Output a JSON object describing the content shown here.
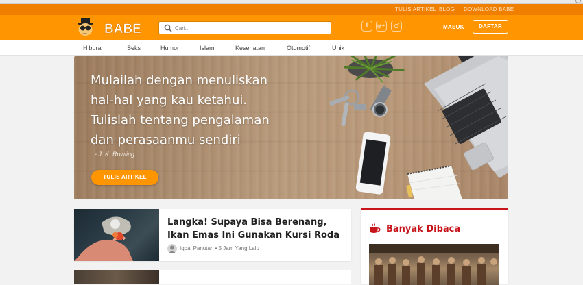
{
  "topbar": {
    "links": [
      "TULIS ARTIKEL",
      "BLOG",
      "DOWNLOAD BABE"
    ]
  },
  "header": {
    "logo_text": "BABE",
    "search_placeholder": "Cari...",
    "social_icons": [
      "facebook-icon",
      "google-plus-icon",
      "instagram-icon"
    ],
    "login_label": "MASUK",
    "register_label": "DAFTAR",
    "accent_color": "#ff9500"
  },
  "nav": {
    "items": [
      "Hiburan",
      "Seks",
      "Humor",
      "Islam",
      "Kesehatan",
      "Otomotif",
      "Unik"
    ]
  },
  "hero": {
    "quote_lines": [
      "Mulailah dengan menuliskan",
      "hal-hal yang kau ketahui.",
      "Tulislah tentang pengalaman",
      "dan perasaanmu sendiri"
    ],
    "author": "- J. K. Rowling",
    "cta_label": "TULIS ARTIKEL"
  },
  "articles": [
    {
      "title": "Langka! Supaya Bisa Berenang, Ikan Emas Ini Gunakan Kursi Roda",
      "author": "Iqbal Panutan",
      "time": "5 Jam Yang Lalu"
    }
  ],
  "sidebar": {
    "title": "Banyak Dibaca",
    "accent_color": "#c8151b"
  }
}
